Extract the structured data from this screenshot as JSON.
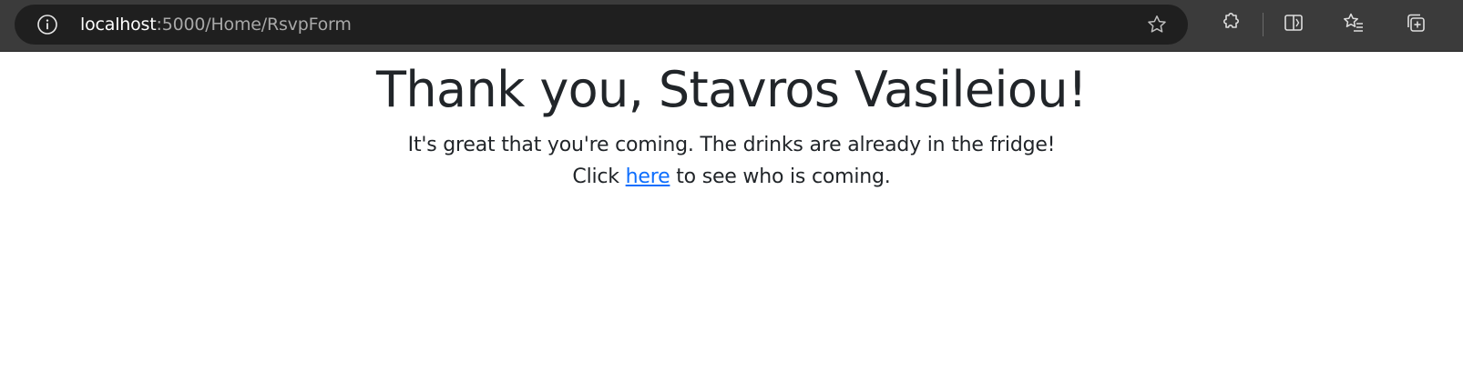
{
  "browser": {
    "url_host": "localhost",
    "url_path": ":5000/Home/RsvpForm",
    "icons": {
      "site_info": "info-circle-icon",
      "favorite": "star-icon",
      "extensions": "puzzle-icon",
      "split_screen": "split-screen-icon",
      "favorites": "favorites-list-icon",
      "collections": "collections-icon"
    },
    "colors": {
      "toolbar": "#3b3b3b",
      "address_bar": "#1f1f1f",
      "icon": "#d8d8d8"
    }
  },
  "page": {
    "title": "Thank you, Stavros Vasileiou!",
    "message": "It's great that you're coming. The drinks are already in the fridge!",
    "click_prefix": "Click ",
    "link_text": "here",
    "click_suffix": " to see who is coming.",
    "colors": {
      "text": "#212529",
      "link": "#0d6efd"
    }
  }
}
